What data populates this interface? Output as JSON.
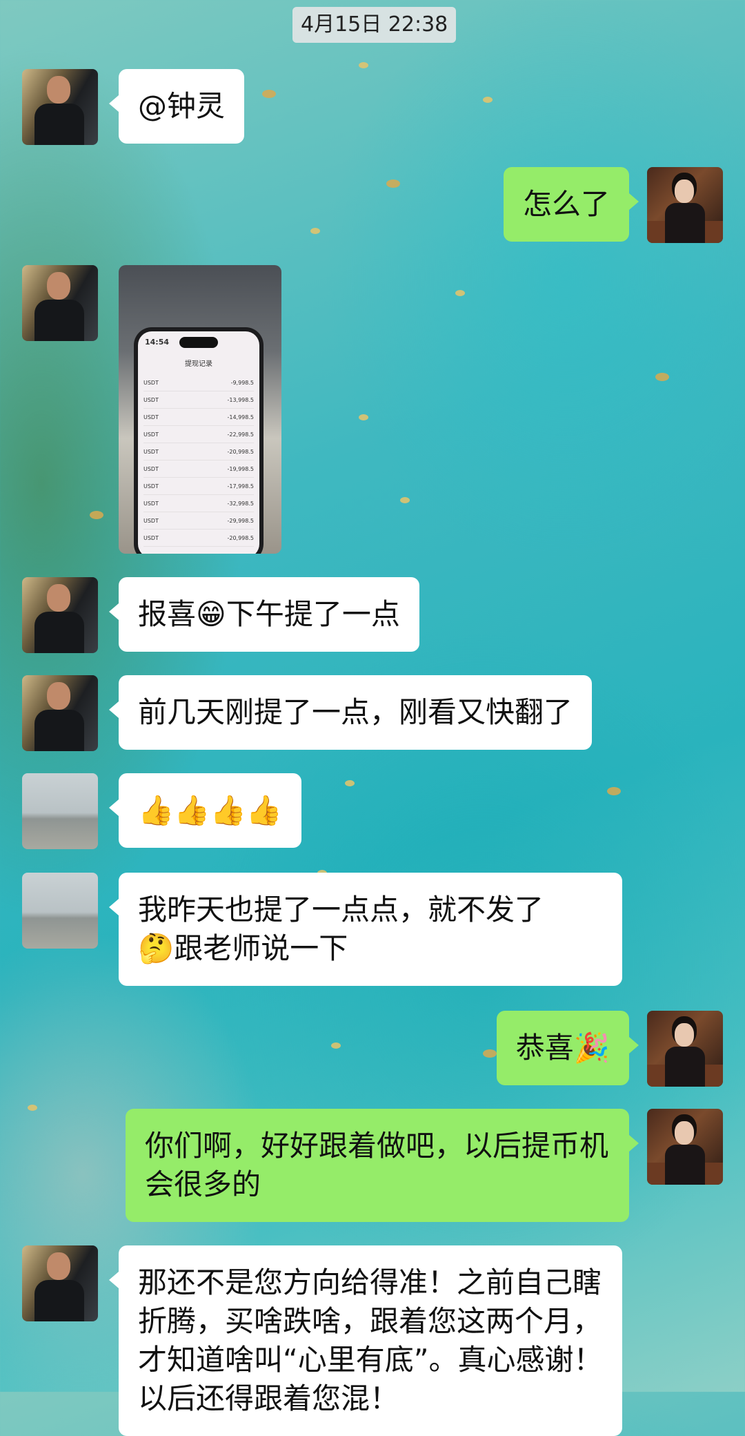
{
  "header": {
    "timestamp": "4月15日 22:38"
  },
  "messages": [
    {
      "side": "in",
      "avatar": "man",
      "text": "@钟灵"
    },
    {
      "side": "out",
      "avatar": "woman",
      "text": "怎么了"
    },
    {
      "side": "in",
      "avatar": "man",
      "type": "image"
    },
    {
      "side": "in",
      "avatar": "man",
      "text_before": "报喜",
      "emoji": "😁",
      "text_after": "下午提了一点"
    },
    {
      "side": "in",
      "avatar": "man",
      "text": "前几天刚提了一点，刚看又快翻了"
    },
    {
      "side": "in",
      "avatar": "landscape",
      "text": "👍👍👍👍"
    },
    {
      "side": "in",
      "avatar": "landscape",
      "text_line1": "我昨天也提了一点点，就不发了",
      "emoji": "🤔",
      "text_line2": "跟老师说一下"
    },
    {
      "side": "out",
      "avatar": "woman",
      "text": "恭喜",
      "emoji": "🎉"
    },
    {
      "side": "out",
      "avatar": "woman",
      "text": "你们啊，好好跟着做吧，以后提币机会很多的"
    },
    {
      "side": "in",
      "avatar": "man",
      "text": "那还不是您方向给得准！之前自己瞎折腾，买啥跌啥，跟着您这两个月，才知道啥叫“心里有底”。真心感谢！以后还得跟着您混！"
    }
  ],
  "photo": {
    "status_time": "14:54",
    "screen_title": "提现记录",
    "records": [
      {
        "coin": "USDT",
        "amount": "-9,998.5"
      },
      {
        "coin": "USDT",
        "amount": "-13,998.5"
      },
      {
        "coin": "USDT",
        "amount": "-14,998.5"
      },
      {
        "coin": "USDT",
        "amount": "-22,998.5"
      },
      {
        "coin": "USDT",
        "amount": "-20,998.5"
      },
      {
        "coin": "USDT",
        "amount": "-19,998.5"
      },
      {
        "coin": "USDT",
        "amount": "-17,998.5"
      },
      {
        "coin": "USDT",
        "amount": "-32,998.5"
      },
      {
        "coin": "USDT",
        "amount": "-29,998.5"
      },
      {
        "coin": "USDT",
        "amount": "-20,998.5"
      }
    ]
  },
  "colors": {
    "bubble_in": "#ffffff",
    "bubble_out": "#95ec69",
    "timestamp_bg": "#e6e6e6"
  }
}
